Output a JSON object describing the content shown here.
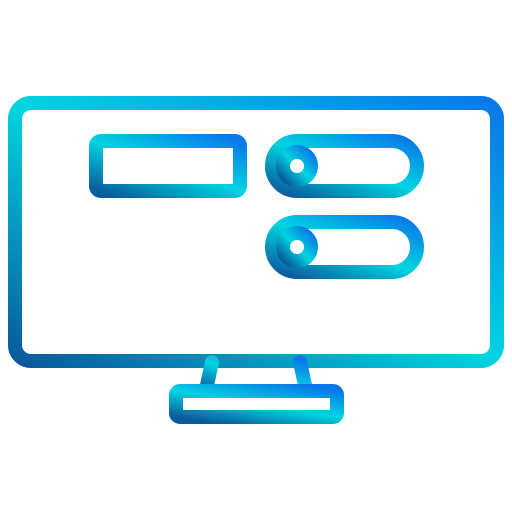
{
  "icon": {
    "name": "monitor-settings-icon",
    "gradient": {
      "start": "#0a5a9c",
      "mid": "#00d4e0",
      "end": "#0a78e8"
    },
    "background": "#ffffff"
  }
}
